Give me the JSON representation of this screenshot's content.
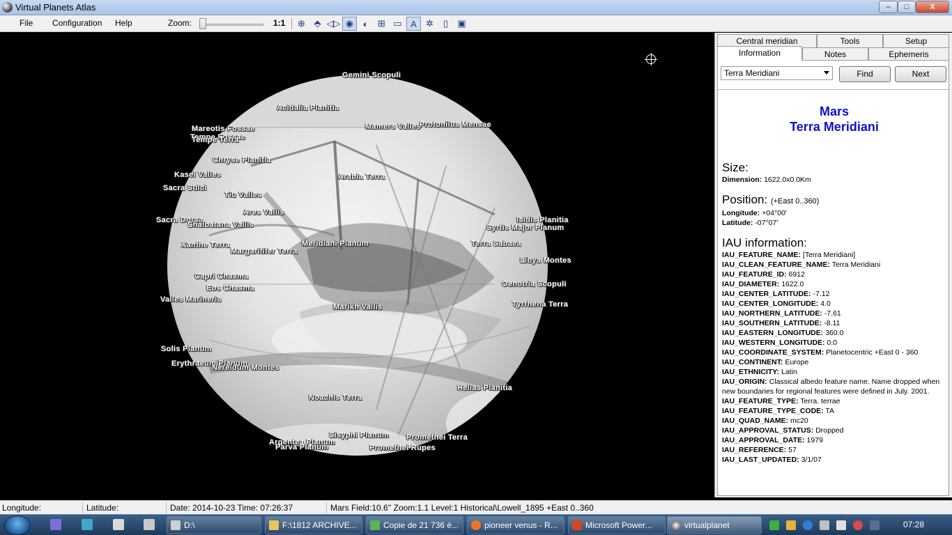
{
  "window": {
    "title": "Virtual Planets Atlas",
    "min_label": "–",
    "max_label": "□",
    "close_label": "X"
  },
  "menu": {
    "items": [
      "File",
      "Configuration",
      "Help"
    ],
    "zoom_label": "Zoom:",
    "zoom_value": "1:1",
    "zoom_level": 0
  },
  "toolbar": {
    "icons": [
      "center-target-icon",
      "flip-vertical-icon",
      "flip-horizontal-icon",
      "globe-view-icon",
      "phase-icon",
      "grid-icon",
      "scale-icon",
      "labels-text-icon",
      "settings-icon",
      "document-icon",
      "screen-icon"
    ],
    "text_button": "A"
  },
  "map": {
    "features": [
      "Gemini Scopuli",
      "Acidalia Planitia",
      "Mareotis Fossae",
      "Tempe Fossae",
      "Tempe Terra",
      "Mamers Valles",
      "Protonilus Mensae",
      "Chryse Planitia",
      "Kasei Valles",
      "Arabia Terra",
      "Sacra Sulci",
      "Tiu Valles",
      "Ares Vallis",
      "Sacra Dorsa",
      "Shalbatana Vallis",
      "Isidis Planitia",
      "Syrtis Major Planum",
      "Xanthe Terra",
      "Meridiani Planum",
      "Margaritifer Terra",
      "Terra Sabaea",
      "Libya Montes",
      "Capri Chasma",
      "Eos Chasma",
      "Oenotria Scopuli",
      "Valles Marineris",
      "Tyrrhena Terra",
      "Marikh Vallis",
      "Solis Planum",
      "Erythraeum Planum",
      "Nereidum Montes",
      "Hellas Planitia",
      "Noachis Terra",
      "Sisyphi Planum",
      "Argentea Planum",
      "Promethei Terra",
      "Parva Planum",
      "Promethei Rupes"
    ]
  },
  "panel": {
    "tabs_top": [
      "Central meridian",
      "Tools",
      "Setup"
    ],
    "tabs_bottom": [
      "Information",
      "Notes",
      "Ephemeris"
    ],
    "selected_feature": "Terra Meridiani",
    "find_label": "Find",
    "next_label": "Next",
    "planet": "Mars",
    "feature_name": "Terra Meridiani",
    "size_heading": "Size:",
    "dimension_label": "Dimension:",
    "dimension_value": "1622.0x0.0Km",
    "position_heading": "Position:",
    "position_note": "(+East 0..360)",
    "longitude_label": "Longitude:",
    "longitude_value": "+04°00'",
    "latitude_label": "Latitude:",
    "latitude_value": "-07°07'",
    "iau_heading": "IAU information:",
    "iau": [
      {
        "k": "IAU_FEATURE_NAME:",
        "v": "[Terra Meridiani]"
      },
      {
        "k": "IAU_CLEAN_FEATURE_NAME:",
        "v": "Terra Meridiani"
      },
      {
        "k": "IAU_FEATURE_ID:",
        "v": "6912"
      },
      {
        "k": "IAU_DIAMETER:",
        "v": "1622.0"
      },
      {
        "k": "IAU_CENTER_LATITUDE:",
        "v": "-7.12"
      },
      {
        "k": "IAU_CENTER_LONGITUDE:",
        "v": "4.0"
      },
      {
        "k": "IAU_NORTHERN_LATITUDE:",
        "v": "-7.61"
      },
      {
        "k": "IAU_SOUTHERN_LATITUDE:",
        "v": "-8.11"
      },
      {
        "k": "IAU_EASTERN_LONGITUDE:",
        "v": "360.0"
      },
      {
        "k": "IAU_WESTERN_LONGITUDE:",
        "v": "0.0"
      },
      {
        "k": "IAU_COORDINATE_SYSTEM:",
        "v": "Planetocentric +East 0 - 360"
      },
      {
        "k": "IAU_CONTINENT:",
        "v": "Europe"
      },
      {
        "k": "IAU_ETHNICITY:",
        "v": "Latin"
      },
      {
        "k": "IAU_ORIGIN:",
        "v": "Classical albedo feature name. Name dropped when new boundaries for regional features were defined in July. 2001."
      },
      {
        "k": "IAU_FEATURE_TYPE:",
        "v": "Terra. terrae"
      },
      {
        "k": "IAU_FEATURE_TYPE_CODE:",
        "v": "TA"
      },
      {
        "k": "IAU_QUAD_NAME:",
        "v": "mc20"
      },
      {
        "k": "IAU_APPROVAL_STATUS:",
        "v": "Dropped"
      },
      {
        "k": "IAU_APPROVAL_DATE:",
        "v": "1979"
      },
      {
        "k": "IAU_REFERENCE:",
        "v": "57"
      },
      {
        "k": "IAU_LAST_UPDATED:",
        "v": "3/1/07"
      }
    ]
  },
  "status": {
    "longitude": "Longitude:",
    "latitude": "Latitude:",
    "datetime": "Date: 2014-10-23   Time: 07:26:37",
    "field": "Mars Field:10.6'' Zoom:1.1  Level:1 Historical\\Lowell_1895  +East 0..360"
  },
  "taskbar": {
    "tasks": [
      "D:\\",
      "F:\\1812 ARCHIVE...",
      "Copie de 21 736 é...",
      "pioneer venus - R...",
      "Microsoft Power...",
      "virtualplanet"
    ],
    "clock": "07:28"
  }
}
